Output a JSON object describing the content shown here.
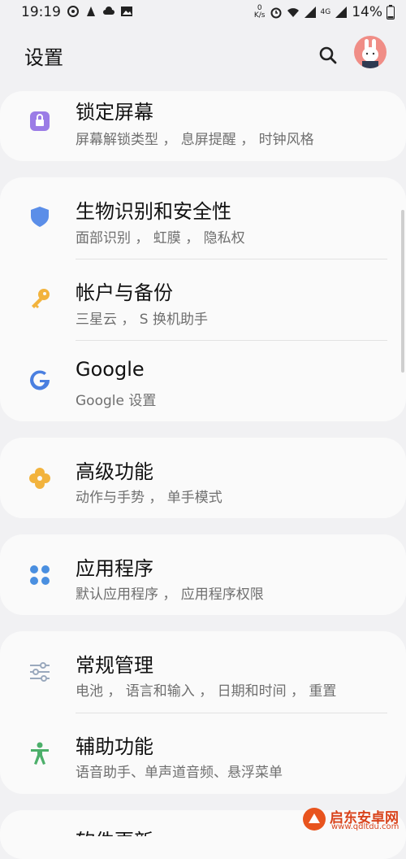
{
  "status": {
    "time": "19:19",
    "net_speed_top": "0",
    "net_speed_bottom": "K/s",
    "network": "4G",
    "battery": "14%"
  },
  "header": {
    "title": "设置"
  },
  "items": [
    {
      "title": "锁定屏幕",
      "subtitle": "屏幕解锁类型 ， 息屏提醒 ， 时钟风格",
      "icon": "lock-icon",
      "color": "#9b7ce6"
    },
    {
      "title": "生物识别和安全性",
      "subtitle": "面部识别 ， 虹膜 ， 隐私权",
      "icon": "shield-icon",
      "color": "#5b8ee8"
    },
    {
      "title": "帐户与备份",
      "subtitle": "三星云 ， S 换机助手",
      "icon": "key-icon",
      "color": "#f2b33d"
    },
    {
      "title": "Google",
      "subtitle": "Google 设置",
      "icon": "google-icon",
      "color": "#4a7fe0"
    },
    {
      "title": "高级功能",
      "subtitle": "动作与手势 ， 单手模式",
      "icon": "gear-flower-icon",
      "color": "#f2b33d"
    },
    {
      "title": "应用程序",
      "subtitle": "默认应用程序 ， 应用程序权限",
      "icon": "apps-grid-icon",
      "color": "#4a8fe0"
    },
    {
      "title": "常规管理",
      "subtitle": "电池 ， 语言和输入 ， 日期和时间 ， 重置",
      "icon": "sliders-icon",
      "color": "#9aa9bd"
    },
    {
      "title": "辅助功能",
      "subtitle": "语音助手、单声道音频、悬浮菜单",
      "icon": "accessibility-icon",
      "color": "#4caf6a"
    },
    {
      "title": "软件更新",
      "subtitle": "",
      "icon": "update-icon",
      "color": "#4a8fe0"
    }
  ],
  "watermark": {
    "text": "启东安卓网",
    "url": "www.qdltdu.com"
  }
}
